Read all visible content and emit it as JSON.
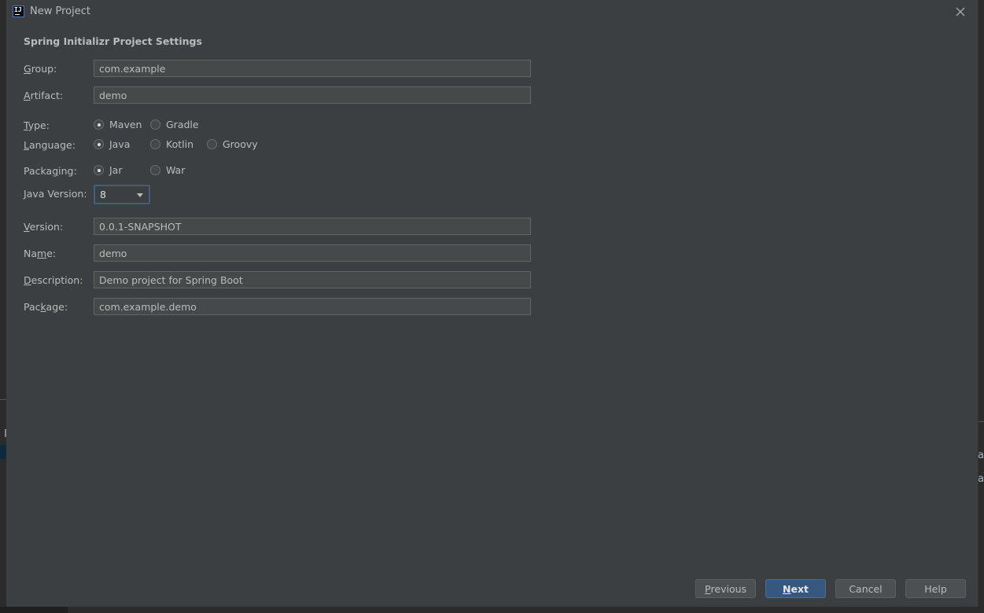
{
  "window": {
    "title": "New Project"
  },
  "section_title": "Spring Initializr Project Settings",
  "fields": {
    "group": {
      "label_u": "G",
      "label_rest": "roup:",
      "value": "com.example"
    },
    "artifact": {
      "label_u": "A",
      "label_rest": "rtifact:",
      "value": "demo"
    },
    "version": {
      "label_u": "V",
      "label_rest": "ersion:",
      "value": "0.0.1-SNAPSHOT"
    },
    "name": {
      "label_pre": "Na",
      "label_u": "m",
      "label_rest": "e:",
      "value": "demo"
    },
    "description": {
      "label_u": "D",
      "label_rest": "escription:",
      "value": "Demo project for Spring Boot"
    },
    "package": {
      "label_pre": "Pac",
      "label_u": "k",
      "label_rest": "age:",
      "value": "com.example.demo"
    }
  },
  "type": {
    "label_u": "T",
    "label_rest": "ype:",
    "options": [
      "Maven",
      "Gradle"
    ],
    "selected": "Maven"
  },
  "language": {
    "label_pre": "",
    "label_u": "L",
    "label_rest": "anguage:",
    "options": [
      "Java",
      "Kotlin",
      "Groovy"
    ],
    "selected": "Java"
  },
  "packaging": {
    "label_pre": "Packa",
    "label_u": "g",
    "label_rest": "ing:",
    "options": [
      "Jar",
      "War"
    ],
    "selected": "Jar"
  },
  "java_version": {
    "label_u": "J",
    "label_rest": "ava Version:",
    "value": "8"
  },
  "buttons": {
    "previous": {
      "u": "P",
      "rest": "revious"
    },
    "next": {
      "u": "N",
      "rest": "ext"
    },
    "cancel": "Cancel",
    "help": "Help"
  },
  "background": {
    "right_text_1": "at",
    "right_text_2": "aS"
  },
  "icons": {
    "close": "close-icon",
    "app": "intellij-logo-icon"
  },
  "colors": {
    "accent": "#365880",
    "focus_border": "#3d6185"
  }
}
